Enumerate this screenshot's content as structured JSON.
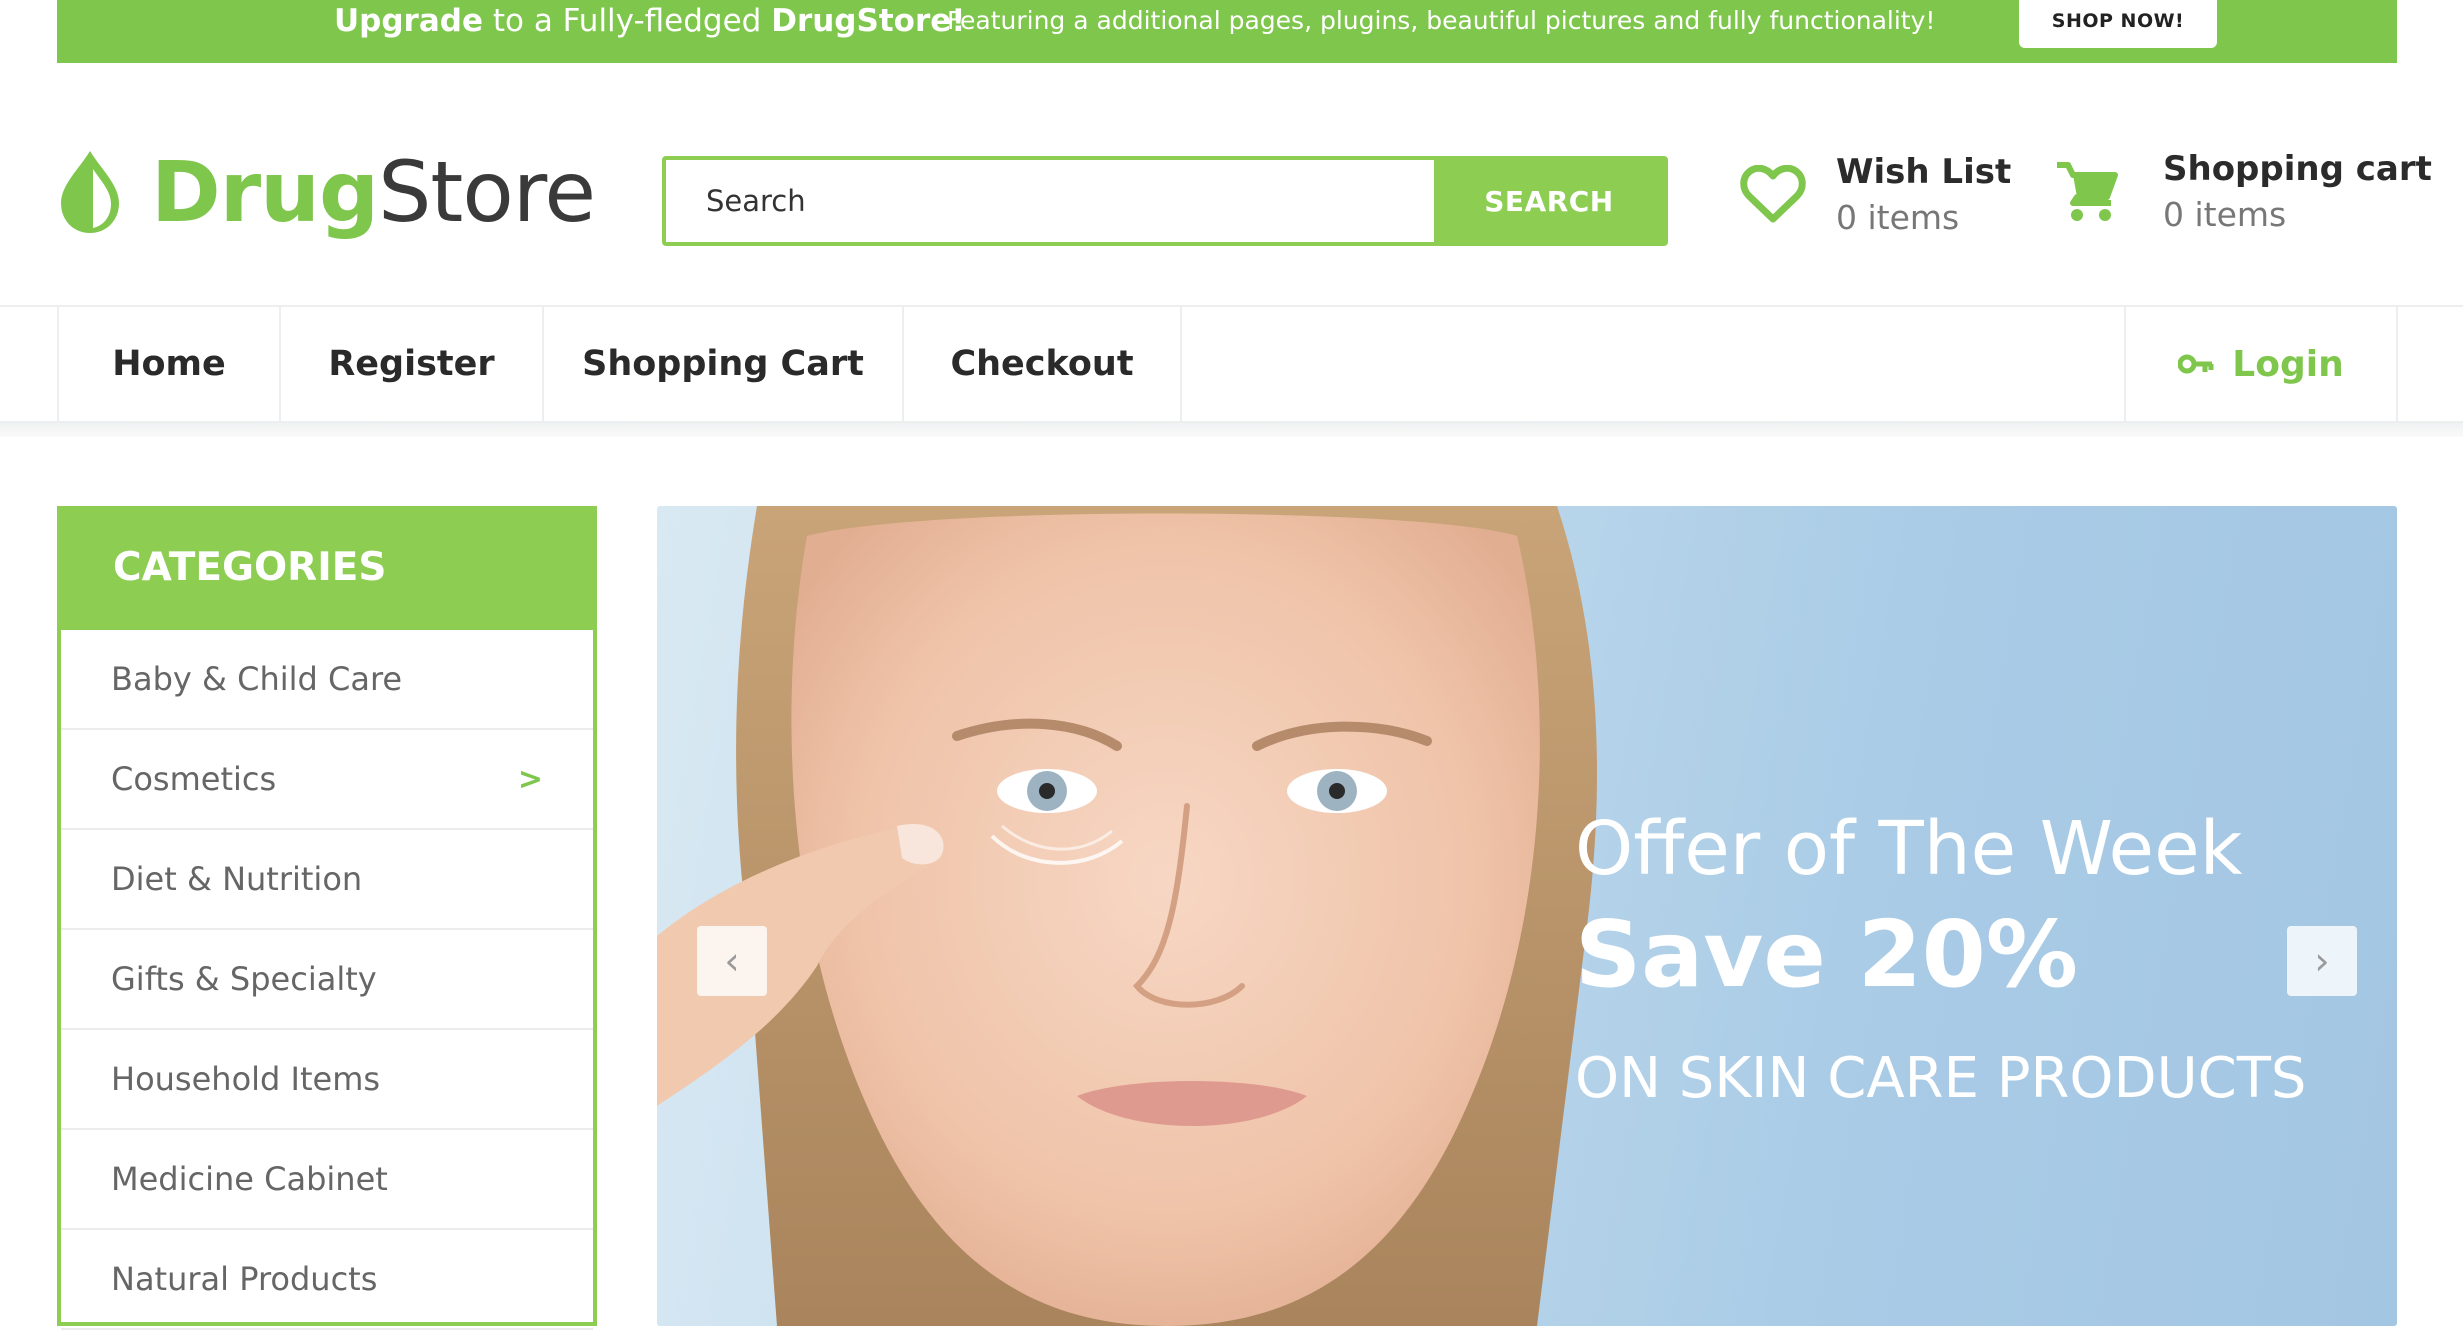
{
  "promo": {
    "headline_bold_1": "Upgrade",
    "headline_mid": " to a Fully-fledged ",
    "headline_bold_2": "DrugStore!",
    "subtext": "Featuring a additional pages, plugins, beautiful pictures and fully functionality!",
    "button_label": "SHOP NOW!"
  },
  "logo": {
    "part1": "Drug",
    "part2": "Store"
  },
  "search": {
    "placeholder": "Search",
    "button_label": "SEARCH"
  },
  "wishlist": {
    "title": "Wish List",
    "count": "0 items"
  },
  "cart": {
    "title": "Shopping cart",
    "count": "0 items"
  },
  "nav": {
    "items": [
      {
        "label": "Home"
      },
      {
        "label": "Register"
      },
      {
        "label": "Shopping Cart"
      },
      {
        "label": "Checkout"
      }
    ],
    "login_label": "Login"
  },
  "categories": {
    "heading": "CATEGORIES",
    "items": [
      {
        "label": "Baby & Child Care"
      },
      {
        "label": "Cosmetics"
      },
      {
        "label": "Diet & Nutrition"
      },
      {
        "label": "Gifts & Specialty"
      },
      {
        "label": "Household Items"
      },
      {
        "label": "Medicine Cabinet"
      },
      {
        "label": "Natural Products"
      }
    ]
  },
  "slider": {
    "line1": "Offer of The Week",
    "line2": "Save 20%",
    "line3": "ON SKIN CARE PRODUCTS",
    "prev_symbol": "‹",
    "next_symbol": "›"
  },
  "colors": {
    "brand_green": "#7fc64c",
    "accent_green": "#8ccd52"
  },
  "icons": [
    "drop-logo-icon",
    "heart-icon",
    "cart-icon",
    "key-icon",
    "chevron-right-icon"
  ]
}
